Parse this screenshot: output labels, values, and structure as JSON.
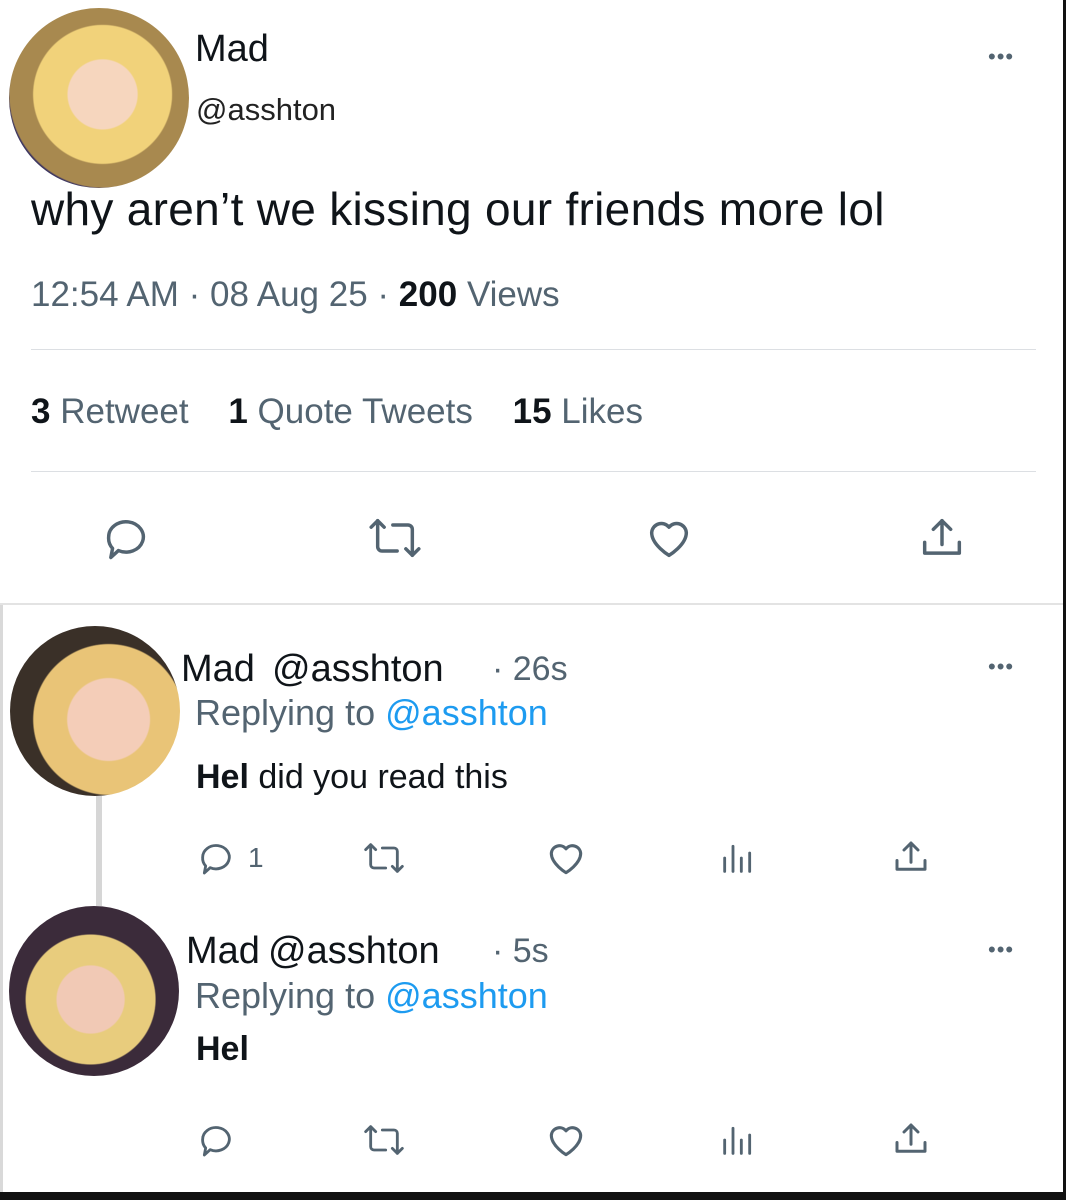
{
  "main_tweet": {
    "name": "Mad",
    "handle": "@asshton",
    "text": "why aren’t we kissing our friends more lol",
    "time": "12:54 AM",
    "date": "08 Aug 25",
    "views_count": "200",
    "views_label": "Views",
    "separator": "·"
  },
  "stats": {
    "retweets_count": "3",
    "retweets_label": "Retweet",
    "quotes_count": "1",
    "quotes_label": "Quote Tweets",
    "likes_count": "15",
    "likes_label": "Likes"
  },
  "replies": [
    {
      "name": "Mad",
      "handle": "@asshton",
      "time": "· 26s",
      "replying_prefix": "Replying to",
      "replying_to": "@asshton",
      "text_bold": "Hel",
      "text": " did you read this",
      "reply_count": "1"
    },
    {
      "name": "Mad",
      "handle": "@asshton",
      "time": "· 5s",
      "replying_prefix": "Replying to",
      "replying_to": "@asshton",
      "text_bold": "Hel",
      "text": ""
    }
  ],
  "colors": {
    "link": "#1d9bf0",
    "secondary_text": "#536471",
    "primary_text": "#0f1419"
  },
  "icons": [
    "comment-icon",
    "retweet-icon",
    "like-icon",
    "share-icon",
    "analytics-icon",
    "more-icon"
  ]
}
